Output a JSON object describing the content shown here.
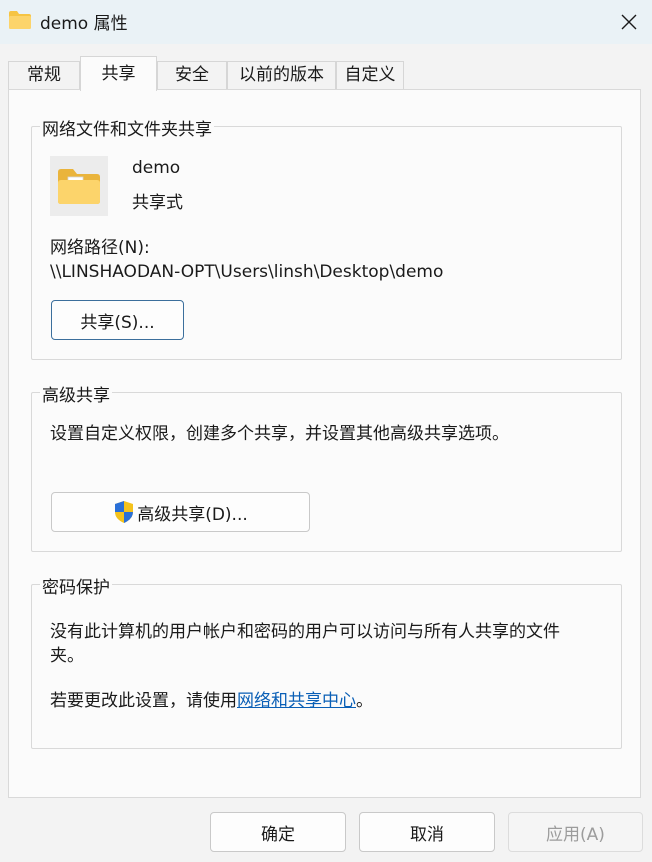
{
  "window": {
    "title": "demo 属性",
    "close_label": "×"
  },
  "tabs": [
    {
      "label": "常规",
      "active": false
    },
    {
      "label": "共享",
      "active": true
    },
    {
      "label": "安全",
      "active": false
    },
    {
      "label": "以前的版本",
      "active": false
    },
    {
      "label": "自定义",
      "active": false
    }
  ],
  "network_share": {
    "title": "网络文件和文件夹共享",
    "folder_name": "demo",
    "status": "共享式",
    "path_label": "网络路径(N):",
    "path": "\\\\LINSHAODAN-OPT\\Users\\linsh\\Desktop\\demo",
    "share_button": "共享(S)..."
  },
  "advanced_share": {
    "title": "高级共享",
    "description": "设置自定义权限，创建多个共享，并设置其他高级共享选项。",
    "button": "高级共享(D)..."
  },
  "password_protection": {
    "title": "密码保护",
    "line1": "没有此计算机的用户帐户和密码的用户可以访问与所有人共享的文件",
    "line2": "夹。",
    "change_prefix": "若要更改此设置，请使用",
    "link": "网络和共享中心",
    "change_suffix": "。"
  },
  "footer": {
    "ok": "确定",
    "cancel": "取消",
    "apply": "应用(A)"
  },
  "colors": {
    "accent": "#3c6f9c",
    "link": "#0a5fb6",
    "folder": "#f6c443"
  }
}
